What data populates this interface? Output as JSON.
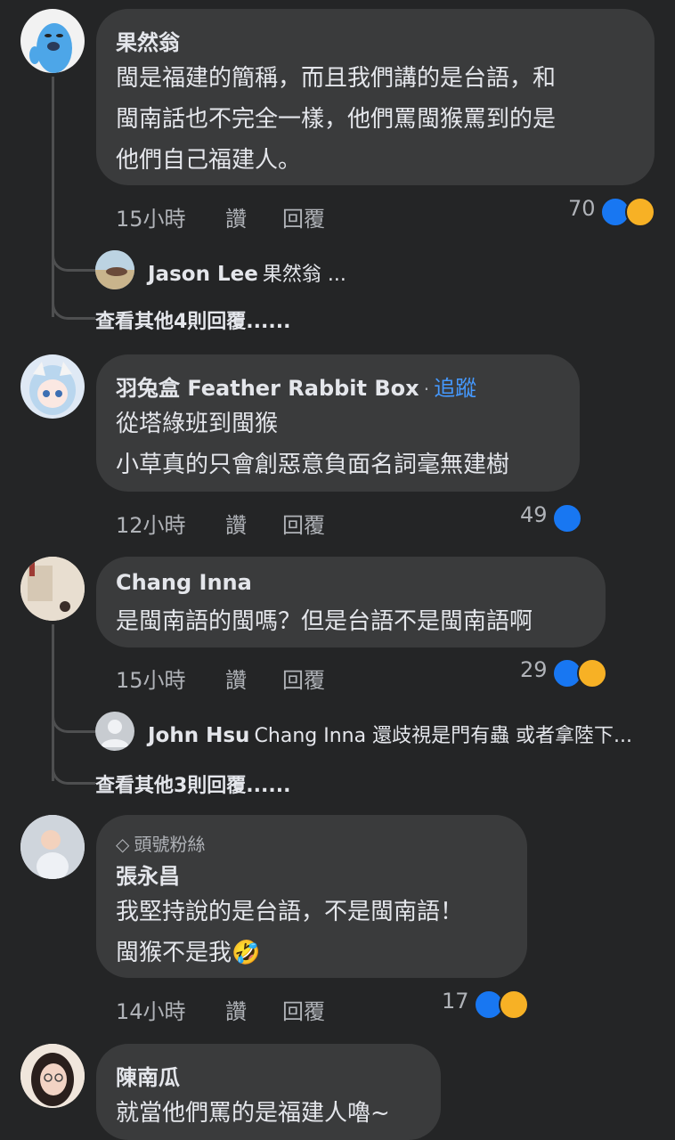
{
  "comments": [
    {
      "author": "果然翁",
      "lines": [
        "閩是福建的簡稱，而且我們講的是台語，和",
        "閩南話也不完全一樣，他們罵閩猴罵到的是",
        "他們自己福建人。"
      ],
      "time": "15小時",
      "like_label": "讚",
      "reply_label": "回覆",
      "reaction_count": "70",
      "reply_preview": {
        "author": "Jason Lee",
        "text": "果然翁 ..."
      },
      "more_replies": "查看其他4則回覆......"
    },
    {
      "author": "羽兔盒 Feather Rabbit Box",
      "follow_sep": "·",
      "follow_label": "追蹤",
      "lines": [
        "從塔綠班到閩猴",
        "小草真的只會創惡意負面名詞毫無建樹"
      ],
      "time": "12小時",
      "like_label": "讚",
      "reply_label": "回覆",
      "reaction_count": "49"
    },
    {
      "author": "Chang Inna",
      "lines": [
        "是閩南語的閩嗎？但是台語不是閩南語啊"
      ],
      "time": "15小時",
      "like_label": "讚",
      "reply_label": "回覆",
      "reaction_count": "29",
      "reply_preview": {
        "author": "John Hsu",
        "text": "Chang Inna 還歧視是門有蟲 或者拿陸下..."
      },
      "more_replies": "查看其他3則回覆......"
    },
    {
      "badge": "頭號粉絲",
      "author": "張永昌",
      "lines": [
        "我堅持說的是台語，不是閩南語！",
        "閩猴不是我🤣"
      ],
      "time": "14小時",
      "like_label": "讚",
      "reply_label": "回覆",
      "reaction_count": "17"
    },
    {
      "author": "陳南瓜",
      "lines": [
        "就當他們罵的是福建人嚕~"
      ]
    }
  ],
  "colors": {
    "background": "#242526",
    "bubble": "#3a3b3c",
    "text": "#e4e6eb",
    "meta": "#b0b3b8",
    "follow": "#4599ff",
    "like": "#1877f2",
    "haha": "#f7b125"
  }
}
